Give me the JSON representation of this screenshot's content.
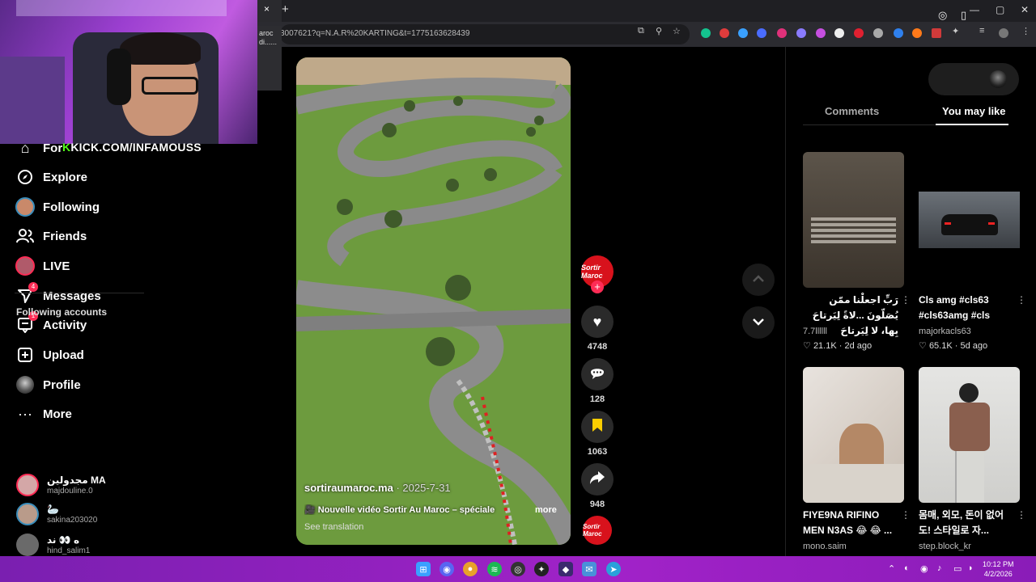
{
  "browser": {
    "tab_close": "×",
    "new_tab": "+",
    "tooltip_lines": [
      "aroc",
      "di......"
    ],
    "url": "3007621?q=N.A.R%20KARTING&t=1775163628439",
    "window_controls": [
      "—",
      "▢",
      "✕"
    ]
  },
  "overlay": {
    "kick_prefix": "K",
    "kick_text": "KICK.COM/INFAMOUSS"
  },
  "sidebar": {
    "items": [
      {
        "label": "For",
        "icon": "home-icon"
      },
      {
        "label": "Explore",
        "icon": "compass-icon"
      },
      {
        "label": "Following",
        "icon": "following-avatar-icon"
      },
      {
        "label": "Friends",
        "icon": "friends-icon"
      },
      {
        "label": "LIVE",
        "icon": "live-icon"
      },
      {
        "label": "Messages",
        "icon": "messages-icon",
        "badge": "4"
      },
      {
        "label": "Activity",
        "icon": "activity-icon",
        "badge": "1"
      },
      {
        "label": "Upload",
        "icon": "upload-icon"
      },
      {
        "label": "Profile",
        "icon": "profile-icon"
      },
      {
        "label": "More",
        "icon": "more-icon"
      }
    ],
    "following_title": "Following accounts",
    "accounts": [
      {
        "name": "مجدولين MA",
        "handle": "majdouline.0"
      },
      {
        "name": "🦢",
        "handle": "sakina203020"
      },
      {
        "name": "ه 👀 ند",
        "handle": "hind_salim1"
      }
    ]
  },
  "video": {
    "username": "sortiraumaroc.ma",
    "date": "· 2025-7-31",
    "caption": "🎥 Nouvelle vidéo Sortir Au Maroc – spéciale",
    "more": "more",
    "translation": "See translation"
  },
  "actions": {
    "avatar_text": "Sortir Maroc",
    "follow_plus": "+",
    "likes": "4748",
    "comments": "128",
    "saves": "1063",
    "shares": "948"
  },
  "right_panel": {
    "tabs": [
      "Comments",
      "You may like"
    ],
    "cards": [
      {
        "title": "رَبِّ اجعلْنا ممّن يُصَلّونَ ...لاةً لِيَرتاحَ بِها، لا لِيَرتاحَ",
        "author": "7.7llllll",
        "likes": "21.1K",
        "age": "2d ago"
      },
      {
        "title": "Cls amg #cls63 #cls63amg #cls",
        "author": "majorkacls63",
        "likes": "65.1K",
        "age": "5d ago"
      },
      {
        "title": "FIYE9NA RIFINO MEN N3AS 😂 😂 ...",
        "author": "mono.saim",
        "likes": "",
        "age": ""
      },
      {
        "title": "몸매, 외모, 돈이 없어도! 스타일로 자...",
        "author": "step.block_kr",
        "likes": "",
        "age": ""
      }
    ]
  },
  "taskbar": {
    "time": "10:12 PM",
    "date": "4/2/2026"
  },
  "colors": {
    "accent": "#fe2c55",
    "brand_red": "#d8121c",
    "kick_green": "#53fc18",
    "taskbar": "#a122c8"
  }
}
